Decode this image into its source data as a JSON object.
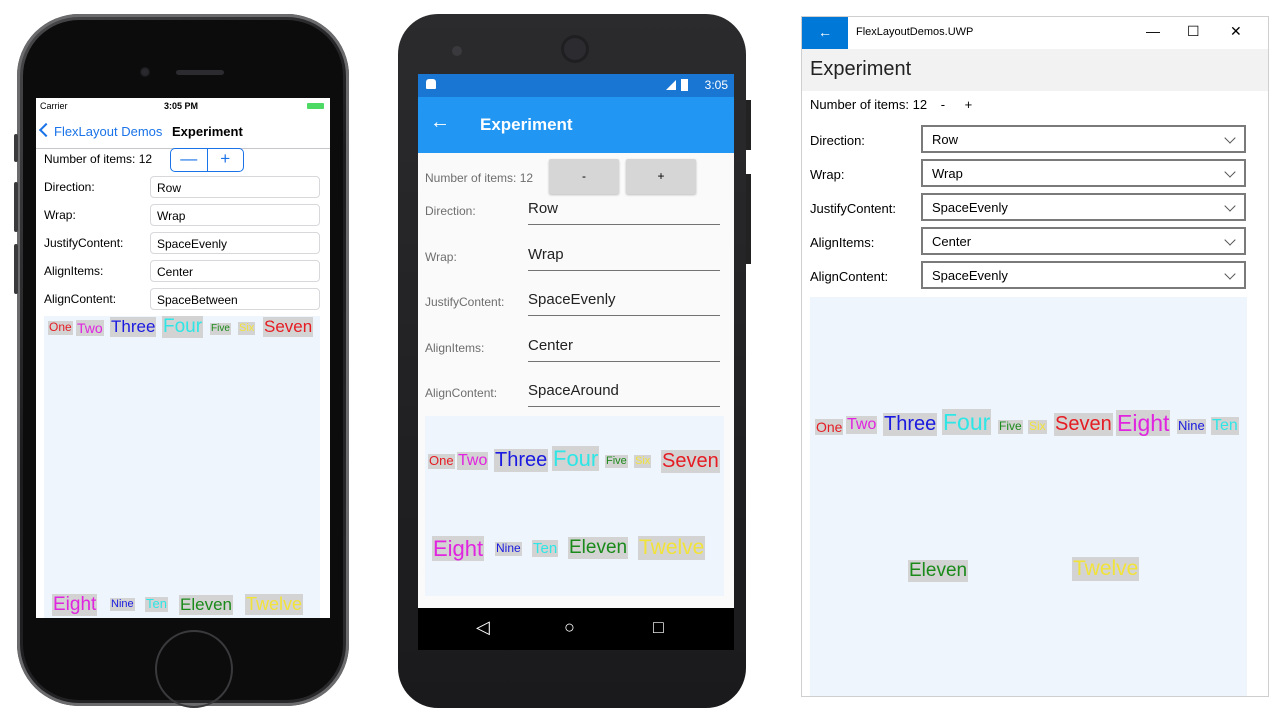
{
  "iphone": {
    "status": {
      "carrier": "Carrier",
      "time": "3:05 PM"
    },
    "nav": {
      "back_label": "FlexLayout Demos",
      "title": "Experiment"
    },
    "count": {
      "label": "Number of items:",
      "value": "12",
      "minus": "—",
      "plus": "+"
    },
    "rows": [
      {
        "label": "Direction:",
        "value": "Row"
      },
      {
        "label": "Wrap:",
        "value": "Wrap"
      },
      {
        "label": "JustifyContent:",
        "value": "SpaceEvenly"
      },
      {
        "label": "AlignItems:",
        "value": "Center"
      },
      {
        "label": "AlignContent:",
        "value": "SpaceBetween"
      }
    ],
    "items": [
      "One",
      "Two",
      "Three",
      "Four",
      "Five",
      "Six",
      "Seven",
      "Eight",
      "Nine",
      "Ten",
      "Eleven",
      "Twelve"
    ]
  },
  "android": {
    "status": {
      "time": "3:05"
    },
    "appbar": {
      "back": "←",
      "title": "Experiment"
    },
    "count": {
      "label": "Number of items:",
      "value": "12",
      "minus": "-",
      "plus": "+"
    },
    "rows": [
      {
        "label": "Direction:",
        "value": "Row"
      },
      {
        "label": "Wrap:",
        "value": "Wrap"
      },
      {
        "label": "JustifyContent:",
        "value": "SpaceEvenly"
      },
      {
        "label": "AlignItems:",
        "value": "Center"
      },
      {
        "label": "AlignContent:",
        "value": "SpaceAround"
      }
    ],
    "items": [
      "One",
      "Two",
      "Three",
      "Four",
      "Five",
      "Six",
      "Seven",
      "Eight",
      "Nine",
      "Ten",
      "Eleven",
      "Twelve"
    ],
    "navbar": {
      "back": "◁",
      "home": "○",
      "recents": "□"
    }
  },
  "uwp": {
    "titlebar": {
      "back": "←",
      "app_title": "FlexLayoutDemos.UWP",
      "minimize": "—",
      "maximize": "☐",
      "close": "✕"
    },
    "header": "Experiment",
    "count": {
      "label": "Number of items:",
      "value": "12",
      "minus": "-",
      "plus": "+"
    },
    "rows": [
      {
        "label": "Direction:",
        "value": "Row"
      },
      {
        "label": "Wrap:",
        "value": "Wrap"
      },
      {
        "label": "JustifyContent:",
        "value": "SpaceEvenly"
      },
      {
        "label": "AlignItems:",
        "value": "Center"
      },
      {
        "label": "AlignContent:",
        "value": "SpaceEvenly"
      }
    ],
    "items": [
      "One",
      "Two",
      "Three",
      "Four",
      "Five",
      "Six",
      "Seven",
      "Eight",
      "Nine",
      "Ten",
      "Eleven",
      "Twelve"
    ]
  }
}
